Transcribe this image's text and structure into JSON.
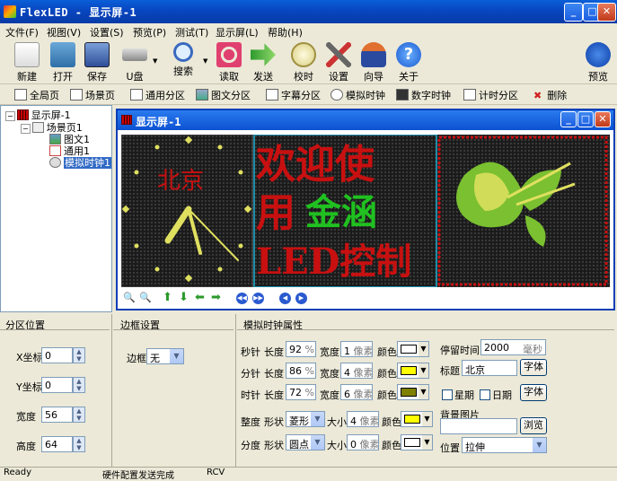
{
  "app": {
    "title": "FlexLED - 显示屏-1"
  },
  "menu": [
    "文件(F)",
    "视图(V)",
    "设置(S)",
    "预览(P)",
    "测试(T)",
    "显示屏(L)",
    "帮助(H)"
  ],
  "toolbar": {
    "new": "新建",
    "open": "打开",
    "save": "保存",
    "usb": "U盘",
    "search": "搜索",
    "read": "读取",
    "send": "发送",
    "calib": "校时",
    "settings": "设置",
    "wizard": "向导",
    "about": "关于",
    "preview": "预览"
  },
  "toolbar2": {
    "global": "全局页",
    "scene": "场景页",
    "general_zone": "通用分区",
    "graphic_zone": "图文分区",
    "subtitle_zone": "字幕分区",
    "analog_clock": "模拟时钟",
    "digital_clock": "数字时钟",
    "timer_zone": "计时分区",
    "delete": "删除"
  },
  "tree": {
    "root": "显示屏-1",
    "scene": "场景页1",
    "n1": "图文1",
    "n2": "通用1",
    "n3": "模拟时钟1"
  },
  "child": {
    "title": "显示屏-1"
  },
  "led": {
    "clock_title": "北京",
    "line1": "欢迎使",
    "line2a": "用",
    "line2b": "金涵",
    "line3": "LED控制"
  },
  "zone": {
    "header": "分区位置",
    "x_label": "X坐标",
    "x": "0",
    "y_label": "Y坐标",
    "y": "0",
    "w_label": "宽度",
    "w": "56",
    "h_label": "高度",
    "h": "64"
  },
  "border": {
    "header": "边框设置",
    "label": "边框",
    "value": "无"
  },
  "clock": {
    "header": "模拟时钟属性",
    "sec_label": "秒针",
    "min_label": "分针",
    "hour_label": "时针",
    "len_label": "长度",
    "width_label": "宽度",
    "color_label": "颜色",
    "pct": "%",
    "px": "像素",
    "sec_len": "92",
    "sec_w": "1",
    "min_len": "86",
    "min_w": "4",
    "hour_len": "72",
    "hour_w": "6",
    "tick_label": "整度",
    "shape_label": "形状",
    "size_label": "大小",
    "tick_shape": "菱形",
    "tick_size": "4",
    "div_label": "分度",
    "div_shape": "圆点",
    "div_size": "0"
  },
  "right": {
    "stay_label": "停留时间",
    "stay": "2000",
    "stay_unit": "毫秒",
    "title_label": "标题",
    "title": "北京",
    "font_btn": "字体",
    "week": "星期",
    "date": "日期",
    "font_btn2": "字体",
    "bg_label": "背景图片",
    "browse": "浏览",
    "pos_label": "位置",
    "pos": "拉伸"
  },
  "status": {
    "s1": "Ready",
    "s2": "硬件配置发送完成",
    "s3": "RCV"
  },
  "colors": {
    "sec": "#ffffff",
    "min": "#ffff00",
    "hour": "#808000",
    "tick": "#ffff00",
    "div": "#ffffff",
    "led_red": "#c81010",
    "led_green": "#20c020",
    "led_yellow": "#e0e060"
  }
}
